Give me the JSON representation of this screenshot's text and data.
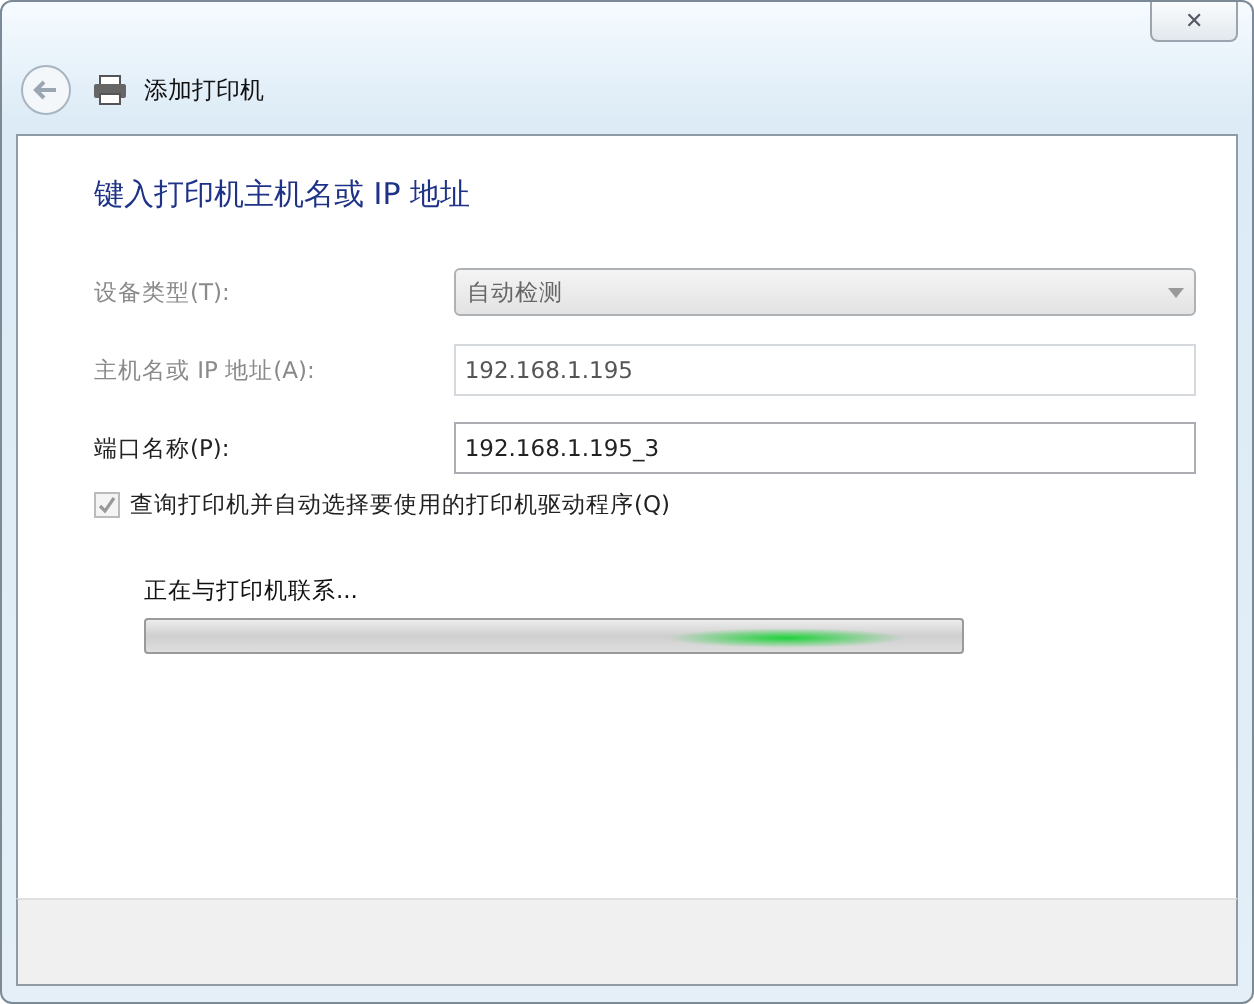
{
  "window": {
    "close": "✕"
  },
  "header": {
    "title": "添加打印机"
  },
  "heading": "键入打印机主机名或 IP 地址",
  "fields": [
    {
      "kind": "dropdown",
      "label": "设备类型(T):",
      "value": "自动检测",
      "disabled": true
    },
    {
      "kind": "text",
      "label": "主机名或 IP 地址(A):",
      "value": "192.168.1.195",
      "disabled": true
    },
    {
      "kind": "text",
      "label": "端口名称(P):",
      "value": "192.168.1.195_3",
      "disabled": false
    }
  ],
  "checkbox": {
    "label": "查询打印机并自动选择要使用的打印机驱动程序(Q)",
    "checked": true,
    "disabled": true
  },
  "progress": {
    "label": "正在与打印机联系...",
    "indeterminate": true
  }
}
